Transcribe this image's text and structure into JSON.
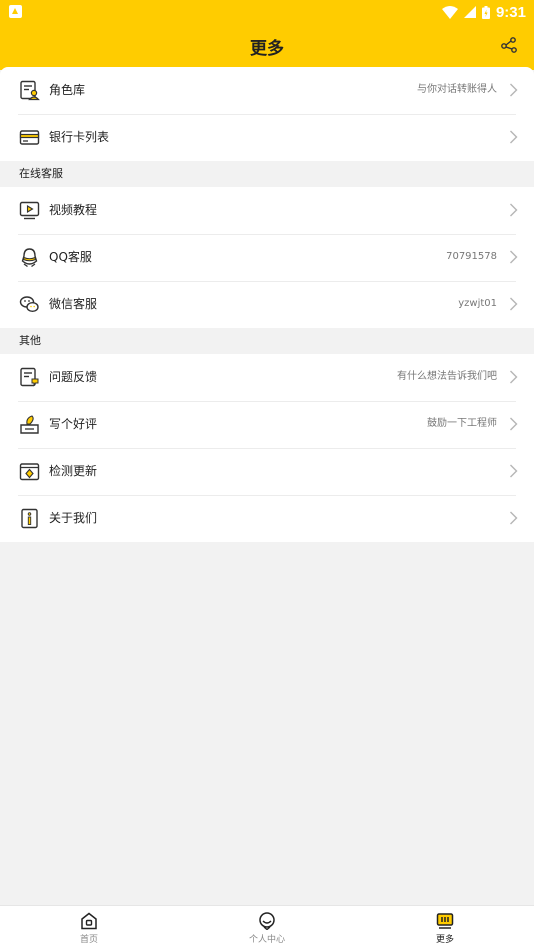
{
  "status_bar": {
    "time": "9:31"
  },
  "app_bar": {
    "title": "更多"
  },
  "groups": {
    "account": {
      "items": [
        {
          "label": "角色库",
          "value": "与你对话转账得人"
        },
        {
          "label": "银行卡列表",
          "value": ""
        }
      ]
    },
    "support": {
      "header": "在线客服",
      "items": [
        {
          "label": "视频教程",
          "value": ""
        },
        {
          "label": "QQ客服",
          "value": "70791578"
        },
        {
          "label": "微信客服",
          "value": "yzwjt01"
        }
      ]
    },
    "other": {
      "header": "其他",
      "items": [
        {
          "label": "问题反馈",
          "value": "有什么想法告诉我们吧"
        },
        {
          "label": "写个好评",
          "value": "鼓励一下工程师"
        },
        {
          "label": "检测更新",
          "value": ""
        },
        {
          "label": "关于我们",
          "value": ""
        }
      ]
    }
  },
  "tab_bar": {
    "tabs": [
      {
        "label": "首页",
        "icon": "home-icon",
        "active": false
      },
      {
        "label": "个人中心",
        "icon": "person-icon",
        "active": false
      },
      {
        "label": "更多",
        "icon": "more-icon",
        "active": true
      }
    ]
  },
  "colors": {
    "accent": "#ffcc00",
    "background": "#f2f2f2"
  }
}
